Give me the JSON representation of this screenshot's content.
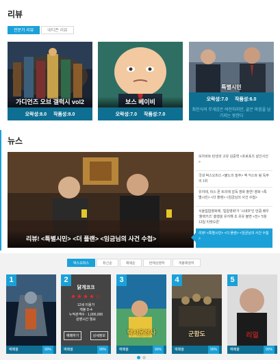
{
  "review": {
    "title": "리뷰",
    "tabs": [
      {
        "label": "전문가 리뷰",
        "active": true
      },
      {
        "label": "네티즌 리뷰",
        "active": false
      }
    ],
    "cards": [
      {
        "title": "가디언즈 오브 갤럭시 vol2",
        "audience_score": "오락성:8.0",
        "critic_score": "작품성:8.0"
      },
      {
        "title": "보스 베이비",
        "audience_score": "오락성:7.0",
        "critic_score": "작품성:7.0"
      },
      {
        "title": "특별시민",
        "audience_score": "오락성:7.0",
        "critic_score": "작품성:6.0",
        "description": "최민식의 무게감은 여전하지만, 끝은 마음을 남기지는 못한다"
      }
    ]
  },
  "news": {
    "title": "뉴스",
    "headline": "리뷰! <특별시민> <더 플랜> <임금님의 사건 수첩>",
    "items": [
      "모차르트 탄생과 고유 김중혁 <프로포즈 살인사건>",
      "국내 박스오피스 <불노의 질주> 엑 익스트 림 독주의 1위",
      "유지태, 라스 폰 트리에 감독 영화 출연! 영화 <특별시민> <더 플랜> <임금님의 사건 수첩>",
      "서울힙합영화제, '힙합영화'가 '시네마'인 만큼 배우 '플렉키즈' 흥행을 유지해 초 유유 불변 <전> '5월 13일 티켓오픈'",
      "리뷰! <특별시민> <더 플랜> <임금님의 사건 수첩>"
    ],
    "active_item": 4
  },
  "box_office": {
    "tabs": [
      {
        "label": "박스오피스",
        "active": true
      },
      {
        "label": "최신순",
        "active": false
      },
      {
        "label": "예매순",
        "active": false
      },
      {
        "label": "현재상영작",
        "active": false
      },
      {
        "label": "개봉예정작",
        "active": false
      }
    ],
    "movies": [
      {
        "rank": "1",
        "title": "",
        "booking": "예매율",
        "percent": "90%",
        "colors": [
          "#0c1a2c",
          "#3a5a7a",
          "#c35a2a"
        ]
      },
      {
        "rank": "2",
        "title": "",
        "booking": "예매율",
        "percent": "90%",
        "colors": [
          "#444444",
          "#555555",
          "#333333"
        ]
      },
      {
        "rank": "3",
        "title": "택시운전사",
        "booking": "예매율",
        "percent": "90%",
        "colors": [
          "#1e6fa0",
          "#4fa36a",
          "#e9c43a"
        ]
      },
      {
        "rank": "4",
        "title": "군함도",
        "booking": "예매율",
        "percent": "90%",
        "colors": [
          "#2c2a26",
          "#6b5e4a",
          "#a58b5d"
        ]
      },
      {
        "rank": "5",
        "title": "리얼",
        "booking": "예매율",
        "percent": "90%",
        "colors": [
          "#dcdcdc",
          "#b02020",
          "#1b1b1b"
        ]
      }
    ],
    "hover_card": {
      "title": "닭개코크",
      "stars": "★★★★☆",
      "info": [
        "12세 이용가",
        "개봉 D-4",
        "누적관객수 : 1,000,000",
        "상영시간 월요"
      ],
      "button_detail": "예매하기",
      "button_more": "상세정보"
    },
    "pagination": {
      "count": 2,
      "active": 0
    }
  }
}
